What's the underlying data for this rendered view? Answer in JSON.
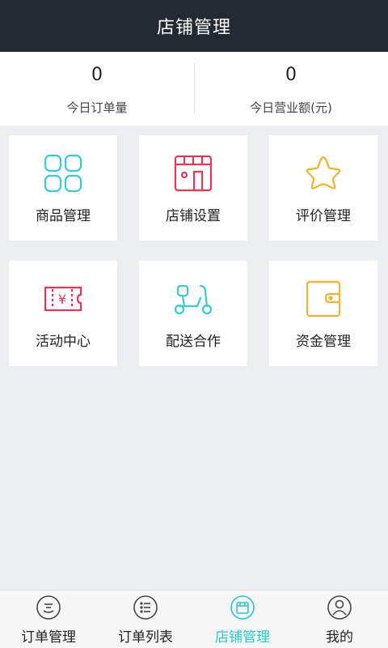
{
  "header": {
    "title": "店铺管理"
  },
  "stats": [
    {
      "value": "0",
      "label": "今日订单量"
    },
    {
      "value": "0",
      "label": "今日营业额(元)"
    }
  ],
  "tiles": [
    {
      "label": "商品管理",
      "icon": "grid-icon",
      "color": "#3ec9cf"
    },
    {
      "label": "店铺设置",
      "icon": "storefront-icon",
      "color": "#e0375b"
    },
    {
      "label": "评价管理",
      "icon": "star-icon",
      "color": "#f2b233"
    },
    {
      "label": "活动中心",
      "icon": "ticket-icon",
      "color": "#e0375b"
    },
    {
      "label": "配送合作",
      "icon": "scooter-icon",
      "color": "#3ec9cf"
    },
    {
      "label": "资金管理",
      "icon": "wallet-icon",
      "color": "#f2b233"
    }
  ],
  "tabs": [
    {
      "label": "订单管理",
      "icon": "order-face-icon",
      "active": false
    },
    {
      "label": "订单列表",
      "icon": "list-icon",
      "active": false
    },
    {
      "label": "店铺管理",
      "icon": "store-icon",
      "active": true
    },
    {
      "label": "我的",
      "icon": "user-icon",
      "active": false
    }
  ],
  "colors": {
    "header_bg": "#232a31",
    "accent": "#2ec4c8",
    "page_bg": "#eceef1"
  }
}
